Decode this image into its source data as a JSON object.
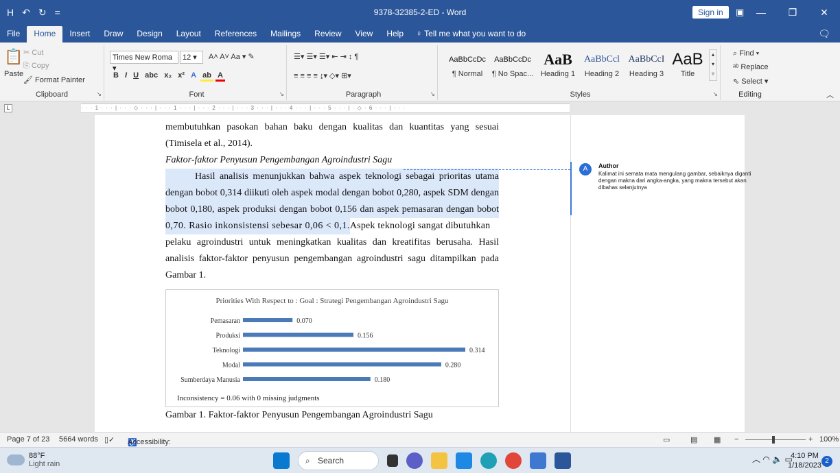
{
  "window": {
    "title": "9378-32385-2-ED  -  Word",
    "sign_in": "Sign in",
    "qat": [
      "H",
      "↶",
      "↻",
      "="
    ]
  },
  "tabs": [
    "File",
    "Home",
    "Insert",
    "Draw",
    "Design",
    "Layout",
    "References",
    "Mailings",
    "Review",
    "View",
    "Help"
  ],
  "tell_me": "Tell me what you want to do",
  "ribbon": {
    "clipboard": {
      "label": "Clipboard",
      "paste": "Paste",
      "cut": "Cut",
      "copy": "Copy",
      "format_painter": "Format Painter"
    },
    "font": {
      "label": "Font",
      "font_name": "Times New Roma",
      "font_size": "12"
    },
    "paragraph": {
      "label": "Paragraph"
    },
    "styles": {
      "label": "Styles",
      "items": [
        {
          "sample": "AaBbCcDc",
          "name": "¶ Normal"
        },
        {
          "sample": "AaBbCcDc",
          "name": "¶ No Spac..."
        },
        {
          "sample": "AaB",
          "name": "Heading 1"
        },
        {
          "sample": "AaBbCcl",
          "name": "Heading 2"
        },
        {
          "sample": "AaBbCcI",
          "name": "Heading 3"
        },
        {
          "sample": "AaB",
          "name": "Title"
        }
      ]
    },
    "editing": {
      "label": "Editing",
      "find": "Find",
      "replace": "Replace",
      "select": "Select"
    }
  },
  "document": {
    "lines": [
      "membutuhkan pasokan bahan baku dengan kualitas dan kuantitas yang sesuai",
      "(Timisela et al., 2014).",
      "Faktor-faktor Penyusun Pengembangan Agroindustri Sagu",
      "Hasil analisis menunjukkan bahwa aspek teknologi sebagai prioritas utama",
      "dengan bobot 0,314 diikuti oleh aspek modal dengan bobot 0,280, aspek SDM dengan",
      "bobot 0,180, aspek produksi dengan bobot 0,156 dan aspek pemasaran dengan bobot",
      "0,70. Rasio inkonsistensi sebesar 0,06 < 0,1.",
      " Aspek teknologi sangat dibutuhkan",
      "pelaku agroindustri untuk meningkatkan kualitas dan kreatifitas berusaha. Hasil",
      "analisis faktor-faktor penyusun pengembangan agroindustri sagu ditampilkan pada",
      "Gambar 1."
    ],
    "caption": "Gambar 1. Faktor-faktor Penyusun Pengembangan Agroindustri Sagu"
  },
  "chart_data": {
    "type": "bar",
    "orientation": "horizontal",
    "title": "Priorities With Respect to : Goal : Strategi Pengembangan Agroindustri Sagu",
    "categories": [
      "Pemasaran",
      "Produksi",
      "Teknologi",
      "Modal",
      "Sumberdaya Manusia"
    ],
    "values": [
      0.07,
      0.156,
      0.314,
      0.28,
      0.18
    ],
    "value_labels": [
      "0.070",
      "0.156",
      "0.314",
      "0.280",
      "0.180"
    ],
    "xlim": [
      0,
      0.314
    ],
    "bar_color": "#4a7ab7",
    "footnote": "Inconsistency = 0.06 with 0 missing judgments"
  },
  "comment": {
    "author": "Author",
    "avatar": "A",
    "text": "Kalimat ini semata mata mengulang gambar, sebaiknya diganti dengan makna dari angka-angka, yang makna tersebut akan dibahas selanjutnya"
  },
  "status": {
    "page": "Page 7 of 23",
    "words": "5664 words",
    "accessibility": "Accessibility: Investigate",
    "zoom": "100%"
  },
  "taskbar": {
    "temp": "88°F",
    "weather": "Light rain",
    "search": "Search",
    "time": "4:10 PM",
    "date": "1/18/2023",
    "notifications": "2"
  }
}
